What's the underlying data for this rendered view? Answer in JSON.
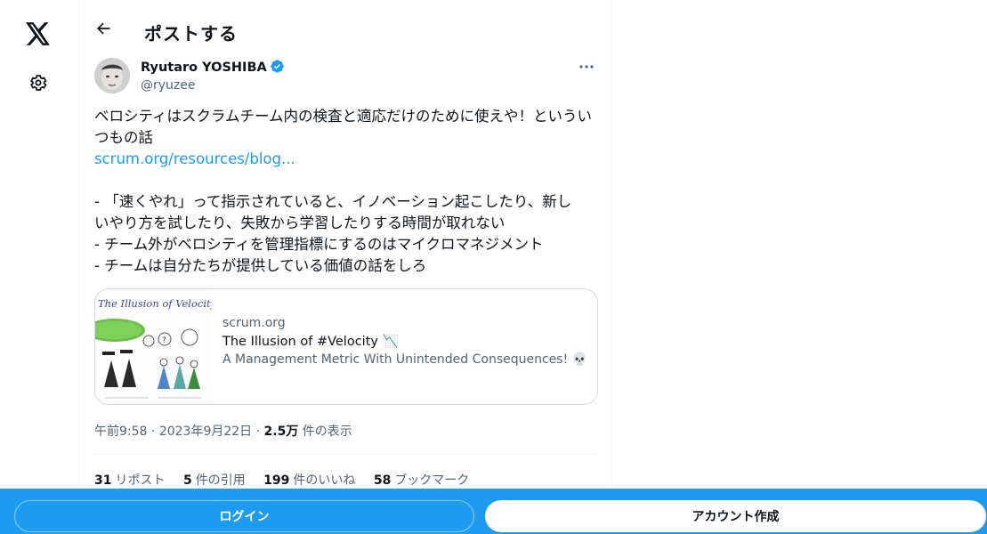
{
  "nav": {
    "logo_icon": "x-logo-icon",
    "settings_icon": "gear-icon"
  },
  "header": {
    "back_icon": "arrow-left-icon",
    "title": "ポストする"
  },
  "author": {
    "name": "Ryutaro YOSHIBA",
    "handle": "@ryuzee",
    "verified_color": "#1d9bf0"
  },
  "tweet": {
    "text_1": "ベロシティはスクラムチーム内の検査と適応だけのために使えや！というい\nつもの話",
    "link": "scrum.org/resources/blog...",
    "text_2": "\n- 「速くやれ」って指示されていると、イノベーション起こしたり、新し\nいやり方を試したり、失敗から学習したりする時間が取れない\n- チーム外がベロシティを管理指標にするのはマイクロマネジメント\n- チームは自分たちが提供している価値の話をしろ"
  },
  "card": {
    "thumb_title": "The Illusion of Velocity",
    "domain": "scrum.org",
    "title": "The Illusion of #Velocity 📉",
    "description": "A Management Metric With Unintended Consequences! 💀"
  },
  "meta": {
    "time": "午前9:58",
    "date": "2023年9月22日",
    "views_count": "2.5万",
    "views_label": "件の表示",
    "separator": "·"
  },
  "stats": {
    "reposts_count": "31",
    "reposts_label": "リポスト",
    "quotes_count": "5",
    "quotes_label": "件の引用",
    "likes_count": "199",
    "likes_label": "件のいいね",
    "bookmarks_count": "58",
    "bookmarks_label": "ブックマーク"
  },
  "bottom_bar": {
    "login_label": "ログイン",
    "signup_label": "アカウント作成",
    "background": "#1d9bf0"
  }
}
